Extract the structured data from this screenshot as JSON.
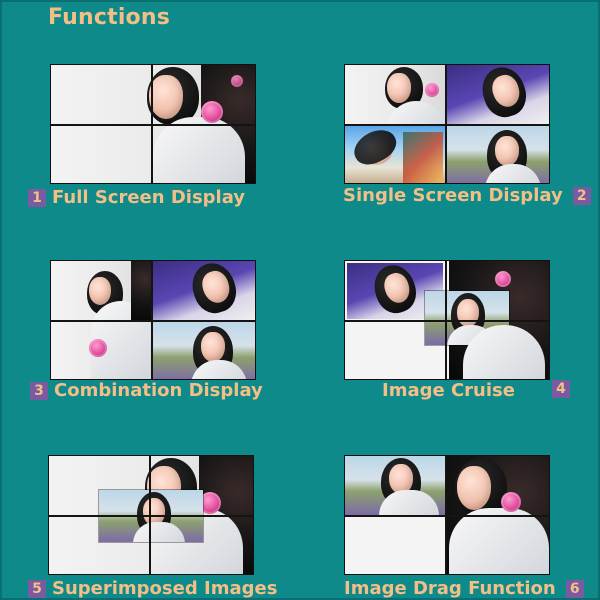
{
  "page": {
    "title": "Functions"
  },
  "features": [
    {
      "number": "1",
      "label": "Full Screen Display"
    },
    {
      "number": "2",
      "label": "Single Screen Display"
    },
    {
      "number": "3",
      "label": "Combination Display"
    },
    {
      "number": "4",
      "label": "Image Cruise"
    },
    {
      "number": "5",
      "label": "Superimposed Images"
    },
    {
      "number": "6",
      "label": "Image Drag Function"
    }
  ],
  "colors": {
    "background": "#0e8a8a",
    "text_accent": "#f3bf87",
    "badge": "#7a5ba1"
  }
}
